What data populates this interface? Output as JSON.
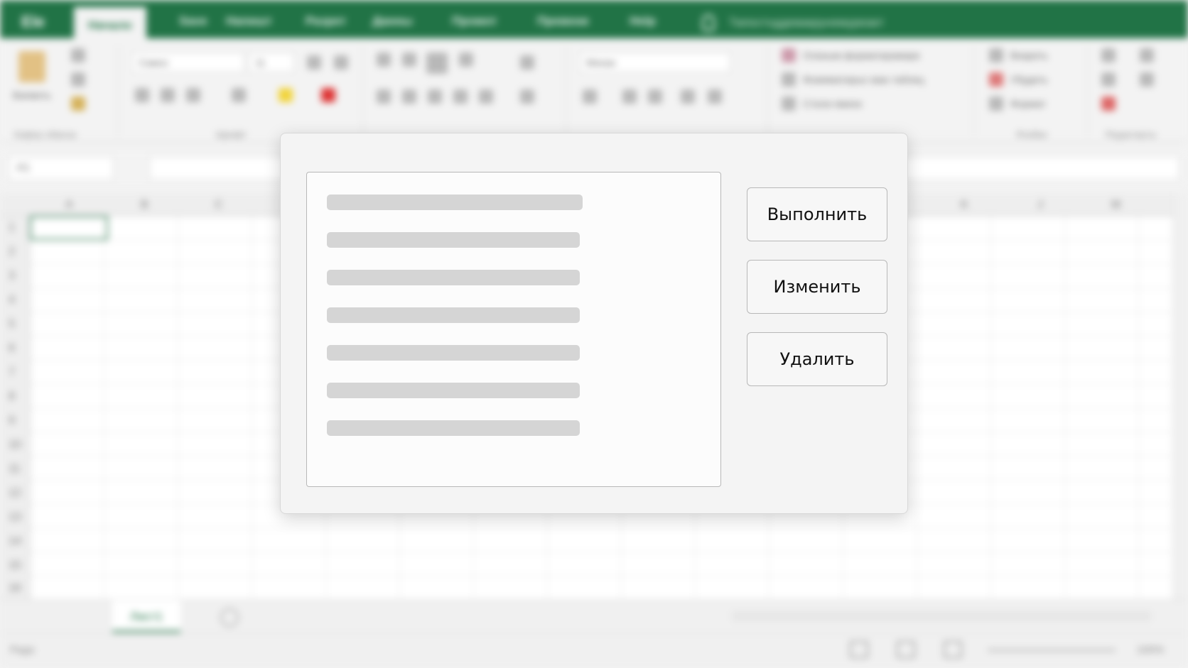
{
  "titlebar": {
    "file_tab": "Ele",
    "tabs": [
      "Начало",
      "Save",
      "Напишт",
      "Разрет",
      "Данны",
      "Промот",
      "Превени",
      "Help"
    ],
    "tell_me": "Тапостхддевакрунемуреакт"
  },
  "ribbon": {
    "paste_label": "Вапвить",
    "font_name": "Самос",
    "font_size": "11",
    "number_format": "Механ",
    "groups": [
      "Кафер обмоза",
      "Шрифт",
      "Ячейки",
      "Редактирты"
    ],
    "styles_items": [
      "Оланым форматирамире",
      "Фомяматирыс ваю таблиц",
      "Стили ямеек"
    ],
    "cells_items": [
      "Вкарить",
      "Убудить",
      "Формат"
    ]
  },
  "formula_bar": {
    "name_box": "A1"
  },
  "grid": {
    "columns": [
      "A",
      "B",
      "C",
      "K",
      "J",
      "M"
    ],
    "rows": [
      "1",
      "2",
      "3",
      "4",
      "5",
      "6",
      "7",
      "8",
      "9",
      "10",
      "11",
      "12",
      "13",
      "14",
      "15",
      "16"
    ]
  },
  "sheet_tabs": {
    "active": "Лист1"
  },
  "status": {
    "ready": "Радо",
    "zoom": "100%"
  },
  "dialog": {
    "list_items": 7,
    "buttons": {
      "run": "Выполнить",
      "edit": "Изменить",
      "delete": "Удалить"
    }
  },
  "colors": {
    "excel_green": "#217346",
    "placeholder_bar": "#d5d5d5"
  }
}
